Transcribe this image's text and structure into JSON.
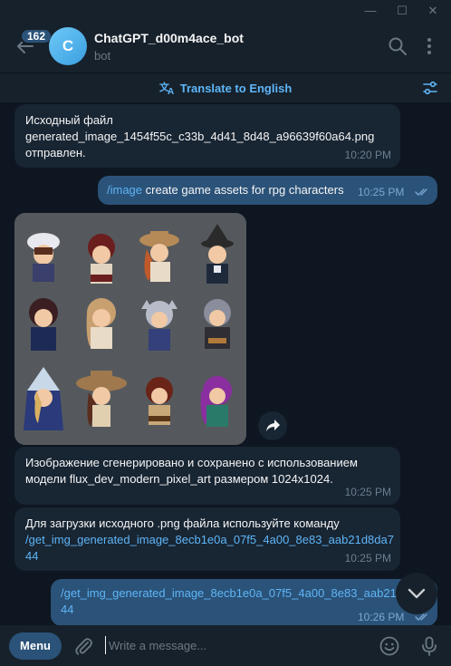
{
  "window": {
    "minimize": "—",
    "maximize": "☐",
    "close": "✕"
  },
  "header": {
    "unread_count": "162",
    "avatar_letter": "C",
    "chat_name": "ChatGPT_d00m4ace_bot",
    "status": "bot"
  },
  "translate": {
    "label": "Translate to English"
  },
  "messages": [
    {
      "direction": "in",
      "text_lines": [
        "Исходный файл",
        "generated_image_1454f55c_c33b_4d41_8d48_a96639f60a64.png",
        "отправлен."
      ],
      "time": "10:20 PM"
    },
    {
      "direction": "out",
      "command": "/image",
      "text": " create game assets for rpg characters",
      "time": "10:25 PM",
      "read": true
    },
    {
      "direction": "in",
      "type": "image",
      "content": "grid of 12 pixel art RPG character sprites"
    },
    {
      "direction": "in",
      "text_lines": [
        "Изображение сгенерировано и сохранено с использованием",
        "модели flux_dev_modern_pixel_art размером 1024x1024."
      ],
      "time": "10:25 PM"
    },
    {
      "direction": "in",
      "text_line": "Для загрузки исходного .png файла используйте команду",
      "link_lines": [
        "/get_img_generated_image_8ecb1e0a_07f5_4a00_8e83_aab21d8da7",
        "44"
      ],
      "time": "10:25 PM"
    },
    {
      "direction": "out",
      "link_lines": [
        "/get_img_generated_image_8ecb1e0a_07f5_4a00_8e83_aab21d",
        "44"
      ],
      "time": "10:26 PM",
      "read": true
    }
  ],
  "input": {
    "menu_label": "Menu",
    "placeholder": "Write a message..."
  },
  "colors": {
    "accent": "#5eb5f7",
    "incoming": "#182533",
    "outgoing": "#2b5278",
    "background": "#0e1621",
    "panel": "#17212b"
  },
  "icons": [
    "back-arrow-icon",
    "search-icon",
    "more-vertical-icon",
    "translate-icon",
    "filter-icon",
    "share-icon",
    "chevron-down-icon",
    "attach-icon",
    "emoji-icon",
    "microphone-icon",
    "double-check-icon"
  ]
}
